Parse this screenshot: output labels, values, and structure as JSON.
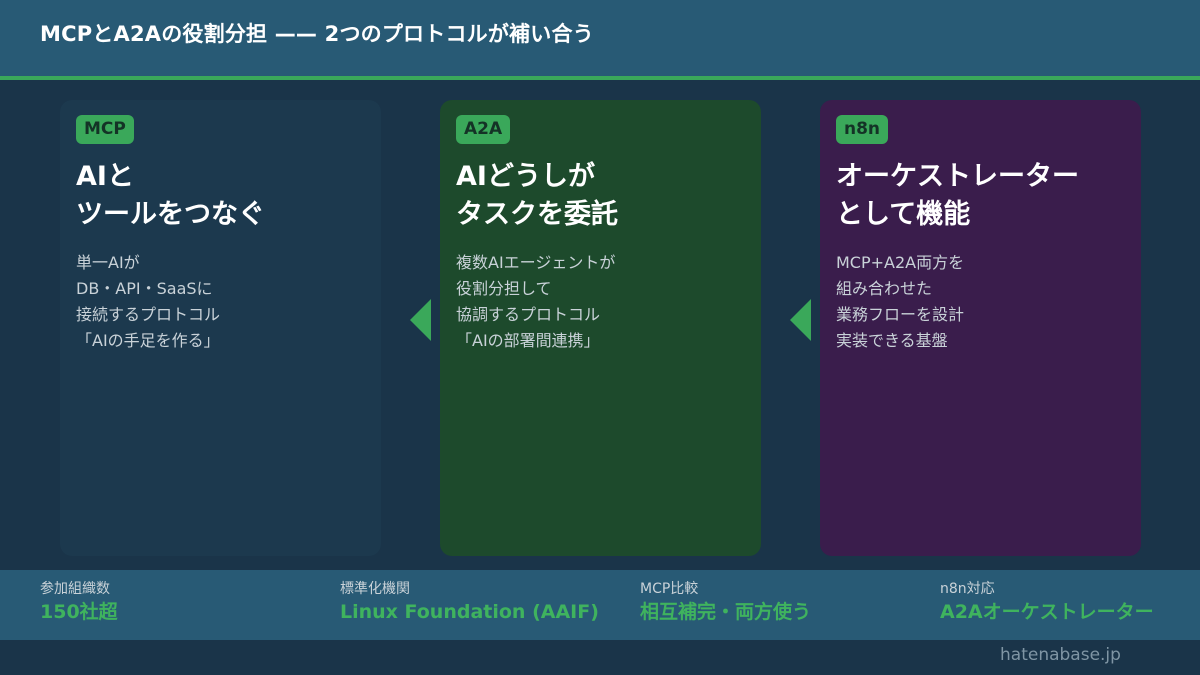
{
  "header": {
    "title": "MCPとA2Aの役割分担 —— 2つのプロトコルが補い合う"
  },
  "cards": [
    {
      "badge": "MCP",
      "title_lines": [
        "AIと",
        "ツールをつなぐ"
      ],
      "desc_lines": [
        "単一AIが",
        "DB・API・SaaSに",
        "接続するプロトコル",
        "「AIの手足を作る」"
      ]
    },
    {
      "badge": "A2A",
      "title_lines": [
        "AIどうしが",
        "タスクを委託"
      ],
      "desc_lines": [
        "複数AIエージェントが",
        "役割分担して",
        "協調するプロトコル",
        "「AIの部署間連携」"
      ]
    },
    {
      "badge": "n8n",
      "title_lines": [
        "オーケストレーター",
        "として機能"
      ],
      "desc_lines": [
        "MCP+A2A両方を",
        "組み合わせた",
        "業務フローを設計",
        "実装できる基盤"
      ]
    }
  ],
  "stats": [
    {
      "label": "参加組織数",
      "value": "150社超"
    },
    {
      "label": "標準化機関",
      "value": "Linux Foundation (AAIF)"
    },
    {
      "label": "MCP比較",
      "value": "相互補完・両方使う"
    },
    {
      "label": "n8n対応",
      "value": "A2Aオーケストレーター"
    }
  ],
  "footer": {
    "site": "hatenabase.jp"
  },
  "colors": {
    "background": "#1a3449",
    "header": "#285a75",
    "accent": "#3aa85a",
    "card_mcp": "#1c394e",
    "card_a2a": "#1d4a2c",
    "card_n8n": "#3a1d4c"
  },
  "icons": {
    "flow_arrow": "triangle-left-icon"
  }
}
